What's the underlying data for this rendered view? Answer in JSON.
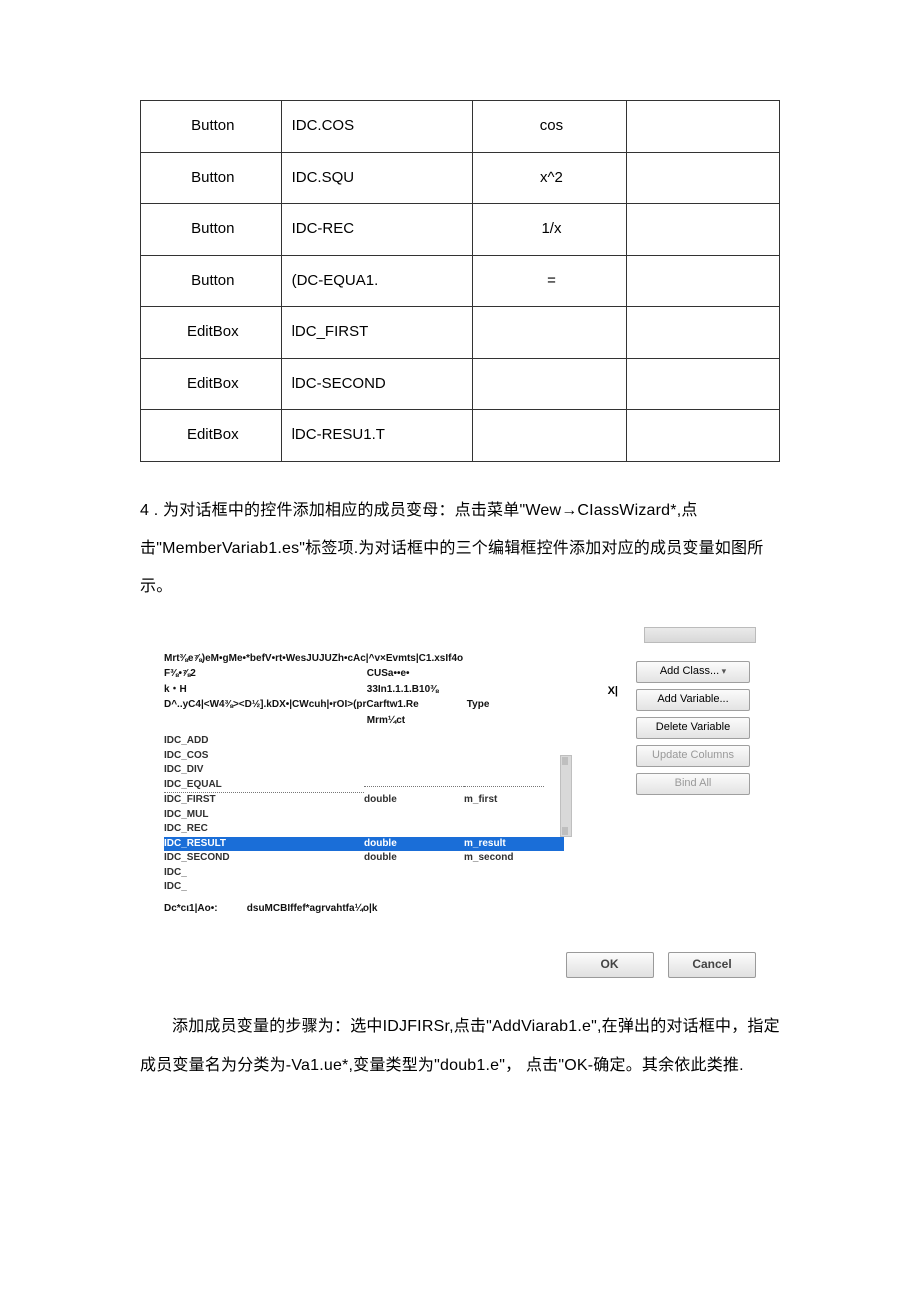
{
  "controls": {
    "rows": [
      {
        "type": "Button",
        "id": "IDC.COS",
        "caption": "cos"
      },
      {
        "type": "Button",
        "id": "IDC.SQU",
        "caption": "x^2"
      },
      {
        "type": "Button",
        "id": "IDC-REC",
        "caption": "1/x"
      },
      {
        "type": "Button",
        "id": "(DC-EQUA1.",
        "caption": "="
      },
      {
        "type": "EditBox",
        "id": "lDC_FIRST",
        "caption": ""
      },
      {
        "type": "EditBox",
        "id": "lDC-SECOND",
        "caption": ""
      },
      {
        "type": "EditBox",
        "id": "lDC-RESU1.T",
        "caption": ""
      }
    ]
  },
  "para1_prefix": "4 .",
  "para1": "为对话框中的控件添加相应的成员变母：点击菜单\"Wew→CIassWizard*,点击\"MemberVariab1.es\"标签项.为对话框中的三个编辑框控件添加对应的成员变量如图所示。",
  "wizard": {
    "header_line": "Mrt⅜e⅞)eM•gMe•*befV•rt•WesJUJUZh•cAc|^v×Evmts|C1.xsIf4o",
    "row2_left": "F⅜•⅞2",
    "row2_mid": "CUSa••e•",
    "row3_left": "k・H",
    "row3_mid": "33In1.1.1.B10⅜",
    "row4_left": "D^..yC4|<W4⅜><D½].kDX•|CWcuh|•rOI>(prCarftw1.Re",
    "row4_right": "Type",
    "row5_mid": "Mrm¼ct",
    "close_x": "X|",
    "ids": [
      {
        "n": "IDC_ADD",
        "t": "",
        "m": ""
      },
      {
        "n": "IDC_COS",
        "t": "",
        "m": ""
      },
      {
        "n": "IDC_DIV",
        "t": "",
        "m": ""
      },
      {
        "n": "IDC_EQUAL",
        "t": "",
        "m": "",
        "dot": true
      },
      {
        "n": "IDC_FIRST",
        "t": "double",
        "m": "m_first"
      },
      {
        "n": "IDC_MUL",
        "t": "",
        "m": ""
      },
      {
        "n": "IDC_REC",
        "t": "",
        "m": ""
      },
      {
        "n": "IDC_RESULT",
        "t": "double",
        "m": "m_result",
        "sel": true
      },
      {
        "n": "IDC_SECOND",
        "t": "double",
        "m": "m_second"
      },
      {
        "n": "IDC_",
        "t": "",
        "m": ""
      },
      {
        "n": "IDC_",
        "t": "",
        "m": ""
      }
    ],
    "desc_label": "Dc*cι1|Ao•:",
    "desc_value": "dsuMCBIffef*agrvahtfa¼o|k",
    "buttons": {
      "add_class": "Add Class...",
      "add_variable": "Add Variable...",
      "delete_variable": "Delete Variable",
      "update_columns": "Update Columns",
      "bind_all": "Bind All"
    },
    "ok": "OK",
    "cancel": "Cancel"
  },
  "para2": "添加成员变量的步骤为：选中IDJFIRSr,点击\"AddViarab1.e\",在弹出的对话框中，指定成员变量名为分类为-Va1.ue*,变量类型为\"doub1.e\"， 点击\"OK-确定。其余依此类推."
}
